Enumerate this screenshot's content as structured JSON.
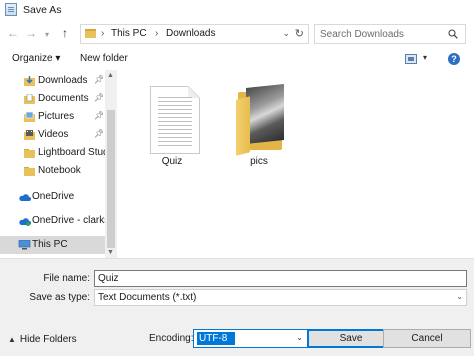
{
  "window": {
    "title": "Save As",
    "icon": "save-as-app-icon"
  },
  "nav": {
    "back_icon": "arrow-left-icon",
    "forward_icon": "arrow-right-icon",
    "recent_icon": "chevron-down-icon",
    "up_icon": "arrow-up-icon",
    "breadcrumb": [
      "This PC",
      "Downloads"
    ],
    "search_placeholder": "Search Downloads"
  },
  "toolbar": {
    "organize": "Organize ▾",
    "new_folder": "New folder"
  },
  "sidebar": {
    "items": [
      {
        "label": "Downloads",
        "icon": "downloads-icon",
        "pinned": true
      },
      {
        "label": "Documents",
        "icon": "documents-icon",
        "pinned": true
      },
      {
        "label": "Pictures",
        "icon": "pictures-icon",
        "pinned": true
      },
      {
        "label": "Videos",
        "icon": "videos-icon",
        "pinned": true
      },
      {
        "label": "Lightboard Studi",
        "icon": "folder-icon",
        "pinned": false
      },
      {
        "label": "Notebook",
        "icon": "folder-icon",
        "pinned": false
      },
      {
        "label": "OneDrive",
        "icon": "onedrive-icon",
        "pinned": false
      },
      {
        "label": "OneDrive - clarksc",
        "icon": "onedrive-business-icon",
        "pinned": false
      },
      {
        "label": "This PC",
        "icon": "this-pc-icon",
        "pinned": false,
        "selected": true
      }
    ]
  },
  "files": [
    {
      "name": "Quiz",
      "type": "text-document"
    },
    {
      "name": "pics",
      "type": "folder"
    }
  ],
  "form": {
    "file_name_label": "File name:",
    "file_name_value": "Quiz",
    "save_type_label": "Save as type:",
    "save_type_value": "Text Documents (*.txt)",
    "hide_folders": "Hide Folders",
    "encoding_label": "Encoding:",
    "encoding_value": "UTF-8",
    "save": "Save",
    "cancel": "Cancel"
  },
  "colors": {
    "accent": "#0078d7",
    "folder": "#e3b547",
    "selection": "#d9d9d9"
  }
}
